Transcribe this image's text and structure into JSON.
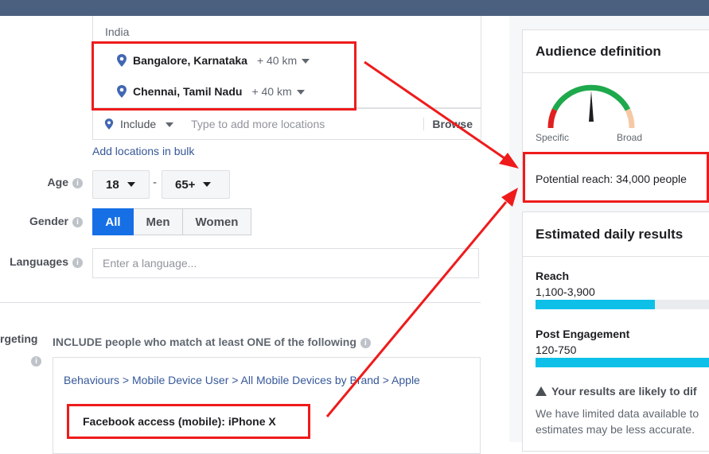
{
  "locations": {
    "country": "India",
    "items": [
      {
        "city": "Bangalore, Karnataka",
        "radius": "+ 40 km"
      },
      {
        "city": "Chennai, Tamil Nadu",
        "radius": "+ 40 km"
      }
    ],
    "include_label": "Include",
    "placeholder": "Type to add more locations",
    "browse_label": "Browse",
    "bulk_link": "Add locations in bulk"
  },
  "age": {
    "label": "Age",
    "min": "18",
    "max": "65+",
    "dash": "-"
  },
  "gender": {
    "label": "Gender",
    "options": [
      "All",
      "Men",
      "Women"
    ],
    "selected": "All"
  },
  "languages": {
    "label": "Languages",
    "placeholder": "Enter a language..."
  },
  "targeting": {
    "label": "rgeting",
    "include_text": "INCLUDE people who match at least ONE of the following",
    "breadcrumb": "Behaviours > Mobile Device User > All Mobile Devices by Brand > Apple",
    "selection": "Facebook access (mobile): iPhone X"
  },
  "audience": {
    "title": "Audience definition",
    "specific_label": "Specific",
    "broad_label": "Broad",
    "potential_reach": "Potential reach: 34,000 people"
  },
  "daily_results": {
    "title": "Estimated daily results",
    "metrics": [
      {
        "name": "Reach",
        "value": "1,100-3,900",
        "fill": 0.69
      },
      {
        "name": "Post Engagement",
        "value": "120-750",
        "fill": 1.0
      }
    ],
    "warning": "Your results are likely to dif",
    "note_line1": "We have limited data available to",
    "note_line2": "estimates may be less accurate."
  },
  "colors": {
    "accent": "#166fe5",
    "annotation": "#ef1b1b",
    "bar": "#0ec0e8",
    "gauge_red": "#e02020",
    "gauge_green": "#1ea94c",
    "gauge_peach": "#f6c9a6"
  },
  "icons": {
    "location_pin": "location-pin-icon",
    "info": "info-icon",
    "warning": "warning-icon"
  }
}
